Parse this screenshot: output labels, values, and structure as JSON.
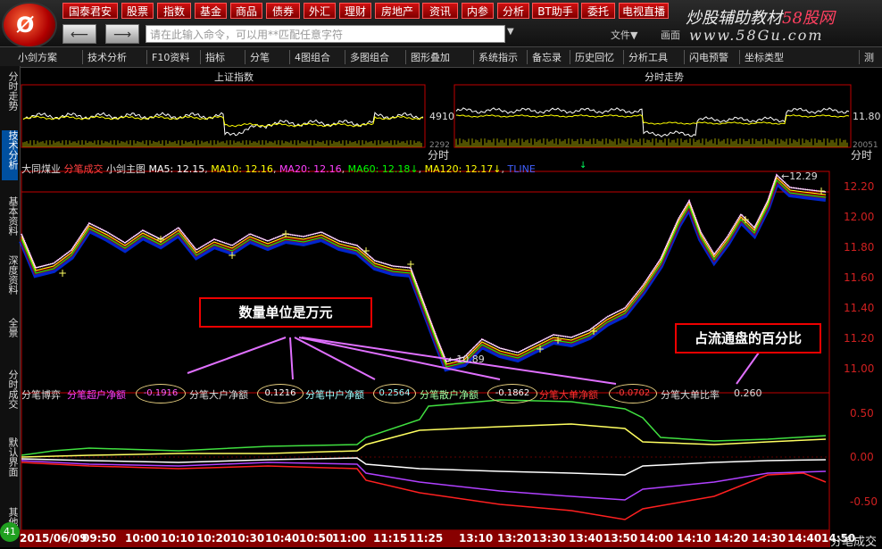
{
  "menu": [
    "国泰君安",
    "股票",
    "指数",
    "基金",
    "商品",
    "债券",
    "外汇",
    "理财",
    "房地产",
    "资讯",
    "内参",
    "分析",
    "BT助手",
    "委托",
    "电视直播"
  ],
  "nav": {
    "back_icon": "back-arrow-icon",
    "forward_icon": "forward-arrow-icon"
  },
  "command": {
    "placeholder": "请在此输入命令，可以用**匹配任意字符"
  },
  "topright": {
    "file": "文件▼",
    "view": "画面"
  },
  "brand": {
    "line1a": "炒股辅助教材",
    "line1b": "58股网",
    "line2": "www.58Gu.com"
  },
  "toolbar": [
    "小剑方案",
    "技术分析",
    "F10资料",
    "指标",
    "分笔",
    "4图组合",
    "多图组合",
    "图形叠加",
    "系统指示",
    "备忘录",
    "历史回忆",
    "分析工具",
    "闪电预警",
    "坐标类型",
    "测"
  ],
  "sidetabs": [
    "分时走势",
    "技术分析",
    "基本资料",
    "深度资料",
    "全景",
    "分时成交",
    "默认界面",
    "其他"
  ],
  "mini": {
    "left_title": "上证指数",
    "right_title": "分时走势",
    "left_price": "4910",
    "left_low": "2292",
    "right_price": "11.80",
    "right_low": "20051",
    "left_fs": "分时",
    "right_fs": "分时"
  },
  "main_header": {
    "stock": "大同煤业",
    "t1": "分笔成交",
    "t2": "小剑主图",
    "ma5": "MA5: 12.15",
    "ma10": "MA10: 12.16",
    "ma20": "MA20: 12.16",
    "ma60": "MA60: 12.18↓",
    "ma120": "MA120: 12.17↓",
    "tline": "TLINE"
  },
  "price_axis": [
    "12.20",
    "12.00",
    "11.80",
    "11.60",
    "11.40",
    "11.20",
    "11.00"
  ],
  "price_annotations": {
    "high": "12.29",
    "low": "10.89"
  },
  "notes": {
    "unit": "数量单位是万元",
    "pct": "占流通盘的百分比"
  },
  "indicator": {
    "name": "分笔博弈",
    "super_label": "分笔超户净额",
    "super_val": "-0.1916",
    "big_label": "分笔大户净额",
    "big_val": "0.1216",
    "mid_label": "分笔中户净额",
    "mid_val": "0.2564",
    "small_label": "分笔散户净额",
    "small_val": "-0.1862",
    "huge_label": "分笔大单净额",
    "huge_val": "-0.0702",
    "ratio_label": "分笔大单比率",
    "ratio_val": "0.260"
  },
  "ind_axis": [
    "0.50",
    "0.00",
    "-0.50"
  ],
  "time_axis": [
    "2015/06/09",
    "09:50",
    "10:00",
    "10:10",
    "10:20",
    "10:30",
    "10:40",
    "10:50",
    "11:00",
    "11:15",
    "11:25",
    "13:10",
    "13:20",
    "13:30",
    "13:40",
    "13:50",
    "14:00",
    "14:10",
    "14:20",
    "14:30",
    "14:40",
    "14:50"
  ],
  "status_right": "分笔成交",
  "badge": "41",
  "colors": {
    "up": "#ff3030",
    "ma5": "#ffffff",
    "ma10": "#ffff00",
    "ma20": "#ff40ff",
    "ma60": "#00ff00",
    "ma120": "#ffff00",
    "tline": "#4060ff"
  }
}
